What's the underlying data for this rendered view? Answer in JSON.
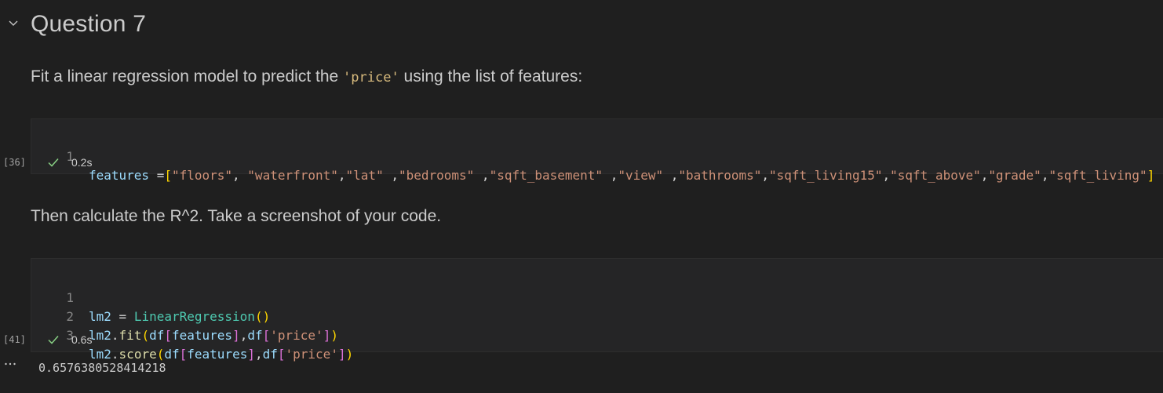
{
  "section": {
    "heading": "Question 7",
    "collapse_icon": "chevron-down-icon"
  },
  "markdown": {
    "p1_before": "Fit a linear regression model to predict the ",
    "p1_code": "'price'",
    "p1_after": " using the list of features:",
    "p2": "Then calculate the R^2. Take a screenshot of your code."
  },
  "cell1": {
    "exec_count": "[36]",
    "line_number": "1",
    "status_icon": "check-icon",
    "duration": "0.2s",
    "tokens": {
      "var": "features",
      "assign": " =",
      "open": "[",
      "s1": "\"floors\"",
      "sep1": ", ",
      "s2": "\"waterfront\"",
      "sep2": ",",
      "s3": "\"lat\"",
      "sep3": " ,",
      "s4": "\"bedrooms\"",
      "sep4": " ,",
      "s5": "\"sqft_basement\"",
      "sep5": " ,",
      "s6": "\"view\"",
      "sep6": " ,",
      "s7": "\"bathrooms\"",
      "sep7": ",",
      "s8": "\"sqft_living15\"",
      "sep8": ",",
      "s9": "\"sqft_above\"",
      "sep9": ",",
      "s10": "\"grade\"",
      "sep10": ",",
      "s11": "\"sqft_living\"",
      "close": "]"
    }
  },
  "cell2": {
    "exec_count": "[41]",
    "status_icon": "check-icon",
    "duration": "0.6s",
    "line_numbers": [
      "1",
      "2",
      "3"
    ],
    "line1": {
      "var": "lm2",
      "assign": " = ",
      "cls": "LinearRegression",
      "open": "(",
      "close": ")"
    },
    "line2": {
      "var": "lm2",
      "dot": ".",
      "fn": "fit",
      "p_open": "(",
      "df1": "df",
      "b_open1": "[",
      "features": "features",
      "b_close1": "]",
      "comma": ",",
      "df2": "df",
      "b_open2": "[",
      "str": "'price'",
      "b_close2": "]",
      "p_close": ")"
    },
    "line3": {
      "var": "lm2",
      "dot": ".",
      "fn": "score",
      "p_open": "(",
      "df1": "df",
      "b_open1": "[",
      "features": "features",
      "b_close1": "]",
      "comma": ",",
      "df2": "df",
      "b_open2": "[",
      "str": "'price'",
      "b_close2": "]",
      "p_close": ")"
    }
  },
  "output": {
    "menu_icon": "ellipsis-icon",
    "value": "0.6576380528414218"
  }
}
